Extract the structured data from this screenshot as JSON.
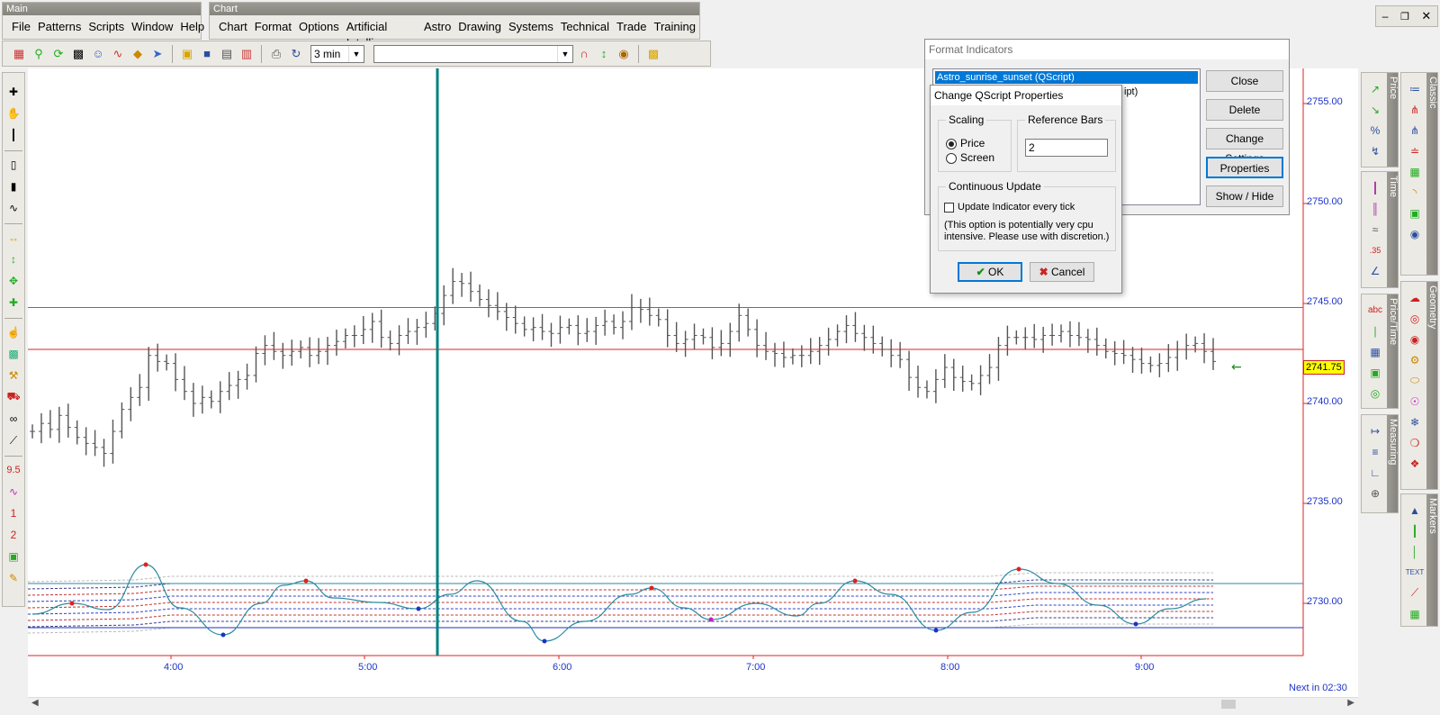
{
  "main_toolbar": {
    "caption": "Main",
    "menus": [
      "File",
      "Patterns",
      "Scripts",
      "Window",
      "Help"
    ]
  },
  "chart_toolbar": {
    "caption": "Chart",
    "menus": [
      "Chart",
      "Format",
      "Options",
      "Artificial Intelligence",
      "Astro",
      "Drawing",
      "Systems",
      "Technical",
      "Trade",
      "Training"
    ]
  },
  "timeframe": {
    "value": "3 min"
  },
  "symbol_combo": {
    "value": ""
  },
  "side_panels": {
    "price": "Price",
    "time": "Time",
    "price_time": "Price/Time",
    "measuring": "Measuring",
    "classic": "Classic",
    "geometry": "Geometry",
    "markers": "Markers"
  },
  "left_tools_text": {
    "nine_five": "9.5",
    "one": "1",
    "two": "2"
  },
  "format_indicators": {
    "title": "Format Indicators",
    "list": [
      "Astro_sunrise_sunset (QScript)",
      "ipt)"
    ],
    "buttons": {
      "close": "Close",
      "delete": "Delete",
      "change_settings": "Change Settings",
      "properties": "Properties",
      "show_hide": "Show / Hide"
    }
  },
  "qscript_dialog": {
    "title": "Change QScript Properties",
    "scaling_label": "Scaling",
    "price_option": "Price",
    "screen_option": "Screen",
    "selected": "Price",
    "reference_bars_label": "Reference Bars",
    "reference_bars_value": "2",
    "continuous_label": "Continuous Update",
    "update_checkbox_label": "Update Indicator every tick",
    "update_checked": false,
    "note": "(This option is potentially very cpu intensive. Please use with discretion.)",
    "ok": "OK",
    "cancel": "Cancel"
  },
  "chart_data": {
    "type": "ohlc",
    "x_ticks": [
      "4:00",
      "5:00",
      "6:00",
      "7:00",
      "8:00",
      "9:00"
    ],
    "y_ticks": [
      "2755.00",
      "2750.00",
      "2745.00",
      "2740.00",
      "2735.00",
      "2730.00"
    ],
    "y_values": [
      2755,
      2750,
      2745,
      2740,
      2735,
      2730
    ],
    "last_price": "2741.75",
    "next_bar": "Next in 02:30",
    "colors": {
      "bars": "#555555",
      "magenta_line": "#e020e0",
      "red_line": "#e02020",
      "vertical_line": "#008080",
      "axis_text": "#1c32c8",
      "indicator": "#2a8aa0"
    },
    "horizontal_lines": [
      2744.8,
      2742.7
    ],
    "bar_closes": [
      2738.6,
      2739.0,
      2738.7,
      2739.4,
      2738.8,
      2738.3,
      2738.0,
      2737.8,
      2737.5,
      2738.6,
      2739.7,
      2740.3,
      2740.8,
      2742.4,
      2742.1,
      2742.0,
      2741.2,
      2740.6,
      2740.0,
      2740.3,
      2740.1,
      2740.6,
      2740.9,
      2741.2,
      2741.4,
      2742.5,
      2742.9,
      2742.6,
      2742.4,
      2742.6,
      2742.8,
      2742.4,
      2742.6,
      2742.9,
      2743.1,
      2743.4,
      2743.4,
      2743.7,
      2744.1,
      2743.3,
      2743.0,
      2743.4,
      2743.6,
      2743.8,
      2744.0,
      2744.5,
      2745.4,
      2746.1,
      2746.0,
      2745.6,
      2745.2,
      2744.9,
      2744.6,
      2744.3,
      2744.0,
      2743.7,
      2743.8,
      2743.6,
      2743.5,
      2743.8,
      2743.9,
      2743.5,
      2743.6,
      2743.9,
      2744.1,
      2743.8,
      2744.1,
      2744.8,
      2744.7,
      2744.4,
      2744.2,
      2743.4,
      2743.0,
      2743.2,
      2743.4,
      2743.3,
      2742.8,
      2743.0,
      2743.6,
      2744.4,
      2743.7,
      2742.9,
      2742.6,
      2742.5,
      2742.3,
      2742.4,
      2742.4,
      2742.6,
      2742.9,
      2743.2,
      2743.6,
      2743.9,
      2743.5,
      2743.3,
      2743.0,
      2742.7,
      2742.4,
      2742.2,
      2741.3,
      2740.8,
      2740.6,
      2741.2,
      2741.8,
      2741.3,
      2741.1,
      2741.0,
      2741.4,
      2741.8,
      2742.9,
      2743.3,
      2743.3,
      2743.3,
      2743.2,
      2743.4,
      2743.4,
      2743.6,
      2743.4,
      2743.3,
      2743.2,
      2742.9,
      2742.6,
      2742.5,
      2742.4,
      2742.2,
      2742.0,
      2741.9,
      2742.0,
      2742.3,
      2742.7,
      2742.9,
      2743.0,
      2742.6,
      2742.1
    ]
  }
}
